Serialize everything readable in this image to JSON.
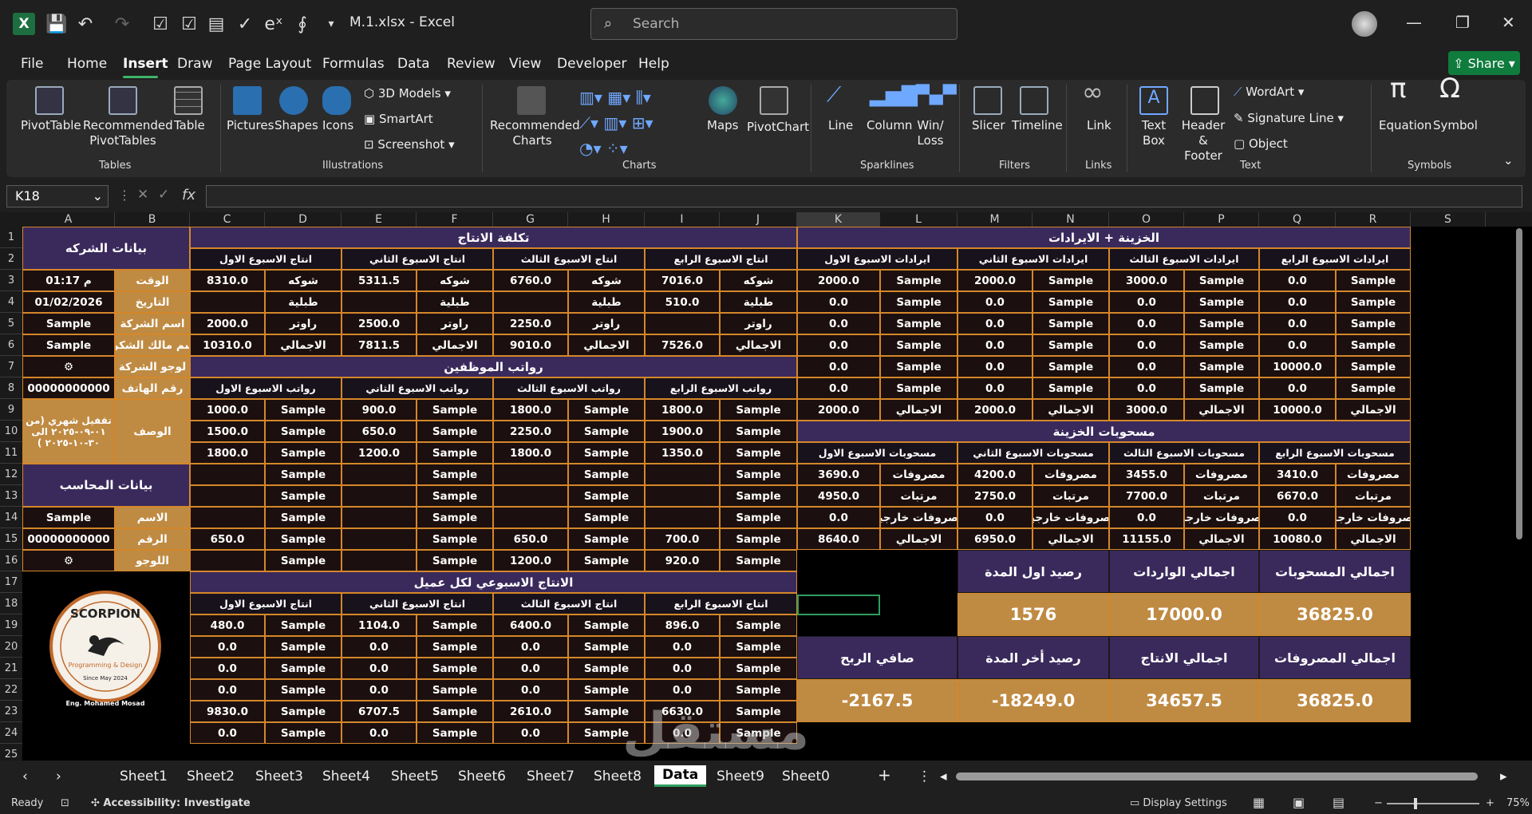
{
  "titlebar": {
    "filename": "M.1.xlsx",
    "sep": "-",
    "app": "Excel",
    "search_placeholder": "Search"
  },
  "menu": [
    "File",
    "Home",
    "Insert",
    "Draw",
    "Page Layout",
    "Formulas",
    "Data",
    "Review",
    "View",
    "Developer",
    "Help"
  ],
  "share_label": "Share",
  "ribbon": {
    "tables": {
      "group": "Tables",
      "items": [
        "PivotTable",
        "Recommended PivotTables",
        "Table"
      ]
    },
    "illustrations": {
      "group": "Illustrations",
      "items": [
        "Pictures",
        "Shapes",
        "Icons"
      ],
      "small": [
        "3D Models",
        "SmartArt",
        "Screenshot"
      ]
    },
    "charts": {
      "group": "Charts",
      "items": [
        "Recommended Charts",
        "Maps",
        "PivotChart"
      ]
    },
    "sparklines": {
      "group": "Sparklines",
      "items": [
        "Line",
        "Column",
        "Win/ Loss"
      ]
    },
    "filters": {
      "group": "Filters",
      "items": [
        "Slicer",
        "Timeline"
      ]
    },
    "links": {
      "group": "Links",
      "items": [
        "Link"
      ]
    },
    "text": {
      "group": "Text",
      "items": [
        "Text Box",
        "Header & Footer"
      ],
      "small": [
        "WordArt",
        "Signature Line",
        "Object"
      ]
    },
    "symbols": {
      "group": "Symbols",
      "items": [
        "Equation",
        "Symbol"
      ]
    }
  },
  "namebox": "K18",
  "columns": [
    "A",
    "B",
    "C",
    "D",
    "E",
    "F",
    "G",
    "H",
    "I",
    "J",
    "K",
    "L",
    "M",
    "N",
    "O",
    "P",
    "Q",
    "R",
    "S"
  ],
  "rows": [
    "1",
    "2",
    "3",
    "4",
    "5",
    "6",
    "7",
    "8",
    "9",
    "10",
    "11",
    "12",
    "13",
    "14",
    "15",
    "16",
    "17",
    "18",
    "19",
    "20",
    "21",
    "22",
    "23",
    "24",
    "25"
  ],
  "sheet": {
    "company_title": "بيانات الشركه",
    "company": [
      [
        "الوقت",
        "01:17 م"
      ],
      [
        "التاريخ",
        "01/02/2026"
      ],
      [
        "اسم الشركة",
        "Sample"
      ],
      [
        "اسم مالك الشكرة",
        "Sample"
      ],
      [
        "لوجو الشركة",
        "⚙"
      ],
      [
        "رقم الهاتف",
        "00000000000"
      ]
    ],
    "desc_label": "الوصف",
    "desc_value": "تقفيل شهري (من ٠١-٠٩-٢٠٢٥ الى ٣٠-١٠-٢٠٢٥ )",
    "accountant_title": "بيانات المحاسب",
    "accountant": [
      [
        "الاسم",
        "Sample"
      ],
      [
        "الرقم",
        "00000000000"
      ],
      [
        "اللوجو",
        "⚙"
      ]
    ],
    "cost_title": "تكلفة الانتاج",
    "cost_weeks": [
      "انتاج الاسبوع الاول",
      "انتاج الاسبوع الثاني",
      "انتاج الاسبوع الثالث",
      "انتاج الاسبوع الرابع"
    ],
    "cost_rows": [
      [
        [
          "8310.0",
          "شوكه"
        ],
        [
          "5311.5",
          "شوكه"
        ],
        [
          "6760.0",
          "شوكه"
        ],
        [
          "7016.0",
          "شوكه"
        ]
      ],
      [
        [
          "",
          "طبلية"
        ],
        [
          "",
          "طبلية"
        ],
        [
          "",
          "طبلية"
        ],
        [
          "510.0",
          "طبلية"
        ]
      ],
      [
        [
          "2000.0",
          "راوتر"
        ],
        [
          "2500.0",
          "راوتر"
        ],
        [
          "2250.0",
          "راوتر"
        ],
        [
          "",
          "راوتر"
        ]
      ],
      [
        [
          "10310.0",
          "الاجمالي"
        ],
        [
          "7811.5",
          "الاجمالي"
        ],
        [
          "9010.0",
          "الاجمالي"
        ],
        [
          "7526.0",
          "الاجمالي"
        ]
      ]
    ],
    "salary_title": "رواتب الموظفين",
    "salary_weeks": [
      "رواتب الاسبوع الاول",
      "رواتب الاسبوع الثاني",
      "رواتب الاسبوع الثالث",
      "رواتب الاسبوع الرابع"
    ],
    "salary_rows": [
      [
        [
          "1000.0",
          "Sample"
        ],
        [
          "900.0",
          "Sample"
        ],
        [
          "1800.0",
          "Sample"
        ],
        [
          "1800.0",
          "Sample"
        ]
      ],
      [
        [
          "1500.0",
          "Sample"
        ],
        [
          "650.0",
          "Sample"
        ],
        [
          "2250.0",
          "Sample"
        ],
        [
          "1900.0",
          "Sample"
        ]
      ],
      [
        [
          "1800.0",
          "Sample"
        ],
        [
          "1200.0",
          "Sample"
        ],
        [
          "1800.0",
          "Sample"
        ],
        [
          "1350.0",
          "Sample"
        ]
      ],
      [
        [
          "",
          "Sample"
        ],
        [
          "",
          "Sample"
        ],
        [
          "",
          "Sample"
        ],
        [
          "",
          "Sample"
        ]
      ],
      [
        [
          "",
          "Sample"
        ],
        [
          "",
          "Sample"
        ],
        [
          "",
          "Sample"
        ],
        [
          "",
          "Sample"
        ]
      ],
      [
        [
          "",
          "Sample"
        ],
        [
          "",
          "Sample"
        ],
        [
          "",
          "Sample"
        ],
        [
          "",
          "Sample"
        ]
      ],
      [
        [
          "650.0",
          "Sample"
        ],
        [
          "",
          "Sample"
        ],
        [
          "650.0",
          "Sample"
        ],
        [
          "700.0",
          "Sample"
        ]
      ],
      [
        [
          "",
          "Sample"
        ],
        [
          "",
          "Sample"
        ],
        [
          "1200.0",
          "Sample"
        ],
        [
          "920.0",
          "Sample"
        ]
      ]
    ],
    "client_title": "الانتاج الاسبوعي لكل عميل",
    "client_weeks": [
      "انتاج الاسبوع الاول",
      "انتاج الاسبوع الثاني",
      "انتاج الاسبوع الثالث",
      "انتاج الاسبوع الرابع"
    ],
    "client_rows": [
      [
        [
          "480.0",
          "Sample"
        ],
        [
          "1104.0",
          "Sample"
        ],
        [
          "6400.0",
          "Sample"
        ],
        [
          "896.0",
          "Sample"
        ]
      ],
      [
        [
          "0.0",
          "Sample"
        ],
        [
          "0.0",
          "Sample"
        ],
        [
          "0.0",
          "Sample"
        ],
        [
          "0.0",
          "Sample"
        ]
      ],
      [
        [
          "0.0",
          "Sample"
        ],
        [
          "0.0",
          "Sample"
        ],
        [
          "0.0",
          "Sample"
        ],
        [
          "0.0",
          "Sample"
        ]
      ],
      [
        [
          "0.0",
          "Sample"
        ],
        [
          "0.0",
          "Sample"
        ],
        [
          "0.0",
          "Sample"
        ],
        [
          "0.0",
          "Sample"
        ]
      ],
      [
        [
          "9830.0",
          "Sample"
        ],
        [
          "6707.5",
          "Sample"
        ],
        [
          "2610.0",
          "Sample"
        ],
        [
          "6630.0",
          "Sample"
        ]
      ],
      [
        [
          "0.0",
          "Sample"
        ],
        [
          "0.0",
          "Sample"
        ],
        [
          "0.0",
          "Sample"
        ],
        [
          "0.0",
          "Sample"
        ]
      ]
    ],
    "treasury_title": "الخزينة + الايرادات",
    "rev_weeks": [
      "ايرادات الاسبوع الاول",
      "ايرادات الاسبوع الثاني",
      "ايرادات الاسبوع الثالث",
      "ايرادات الاسبوع الرابع"
    ],
    "rev_rows": [
      [
        [
          "2000.0",
          "Sample"
        ],
        [
          "2000.0",
          "Sample"
        ],
        [
          "3000.0",
          "Sample"
        ],
        [
          "0.0",
          "Sample"
        ]
      ],
      [
        [
          "0.0",
          "Sample"
        ],
        [
          "0.0",
          "Sample"
        ],
        [
          "0.0",
          "Sample"
        ],
        [
          "0.0",
          "Sample"
        ]
      ],
      [
        [
          "0.0",
          "Sample"
        ],
        [
          "0.0",
          "Sample"
        ],
        [
          "0.0",
          "Sample"
        ],
        [
          "0.0",
          "Sample"
        ]
      ],
      [
        [
          "0.0",
          "Sample"
        ],
        [
          "0.0",
          "Sample"
        ],
        [
          "0.0",
          "Sample"
        ],
        [
          "0.0",
          "Sample"
        ]
      ],
      [
        [
          "0.0",
          "Sample"
        ],
        [
          "0.0",
          "Sample"
        ],
        [
          "0.0",
          "Sample"
        ],
        [
          "10000.0",
          "Sample"
        ]
      ],
      [
        [
          "0.0",
          "Sample"
        ],
        [
          "0.0",
          "Sample"
        ],
        [
          "0.0",
          "Sample"
        ],
        [
          "0.0",
          "Sample"
        ]
      ],
      [
        [
          "2000.0",
          "الاجمالي"
        ],
        [
          "2000.0",
          "الاجمالي"
        ],
        [
          "3000.0",
          "الاجمالي"
        ],
        [
          "10000.0",
          "الاجمالي"
        ]
      ]
    ],
    "withdraw_title": "مسحوبات الخزينة",
    "wd_weeks": [
      "مسحوبات الاسبوع الاول",
      "مسحوبات الاسبوع الثاني",
      "مسحوبات الاسبوع الثالث",
      "مسحوبات الاسبوع الرابع"
    ],
    "wd_rows": [
      [
        [
          "3690.0",
          "مصروفات"
        ],
        [
          "4200.0",
          "مصروفات"
        ],
        [
          "3455.0",
          "مصروفات"
        ],
        [
          "3410.0",
          "مصروفات"
        ]
      ],
      [
        [
          "4950.0",
          "مرتبات"
        ],
        [
          "2750.0",
          "مرتبات"
        ],
        [
          "7700.0",
          "مرتبات"
        ],
        [
          "6670.0",
          "مرتبات"
        ]
      ],
      [
        [
          "0.0",
          "مصروفات خارجية"
        ],
        [
          "0.0",
          "مصروفات خارجية"
        ],
        [
          "0.0",
          "مصروفات خارجية"
        ],
        [
          "0.0",
          "مصروفات خارجية"
        ]
      ],
      [
        [
          "8640.0",
          "الاجمالي"
        ],
        [
          "6950.0",
          "الاجمالي"
        ],
        [
          "11155.0",
          "الاجمالي"
        ],
        [
          "10080.0",
          "الاجمالي"
        ]
      ]
    ],
    "summary1_labels": [
      "رصيد اول المدة",
      "اجمالي الواردات",
      "اجمالي المسحوبات"
    ],
    "summary1_values": [
      "1576",
      "17000.0",
      "36825.0"
    ],
    "summary2_labels": [
      "صافي الربح",
      "رصيد أخر المدة",
      "اجمالي الانتاج",
      "اجمالي المصروفات"
    ],
    "summary2_values": [
      "-2167.5",
      "-18249.0",
      "34657.5",
      "36825.0"
    ],
    "logo_text": "SCORPION",
    "logo_sub": "Programming & Design",
    "logo_since": "Since May 2024",
    "logo_author": "Eng. Mohamed Mosad"
  },
  "tabs": [
    "Sheet1",
    "Sheet2",
    "Sheet3",
    "Sheet4",
    "Sheet5",
    "Sheet6",
    "Sheet7",
    "Sheet8",
    "Data",
    "Sheet9",
    "Sheet0"
  ],
  "status": {
    "ready": "Ready",
    "accessibility": "Accessibility: Investigate",
    "display": "Display Settings",
    "zoom": "75%"
  },
  "watermark": "مستقل"
}
